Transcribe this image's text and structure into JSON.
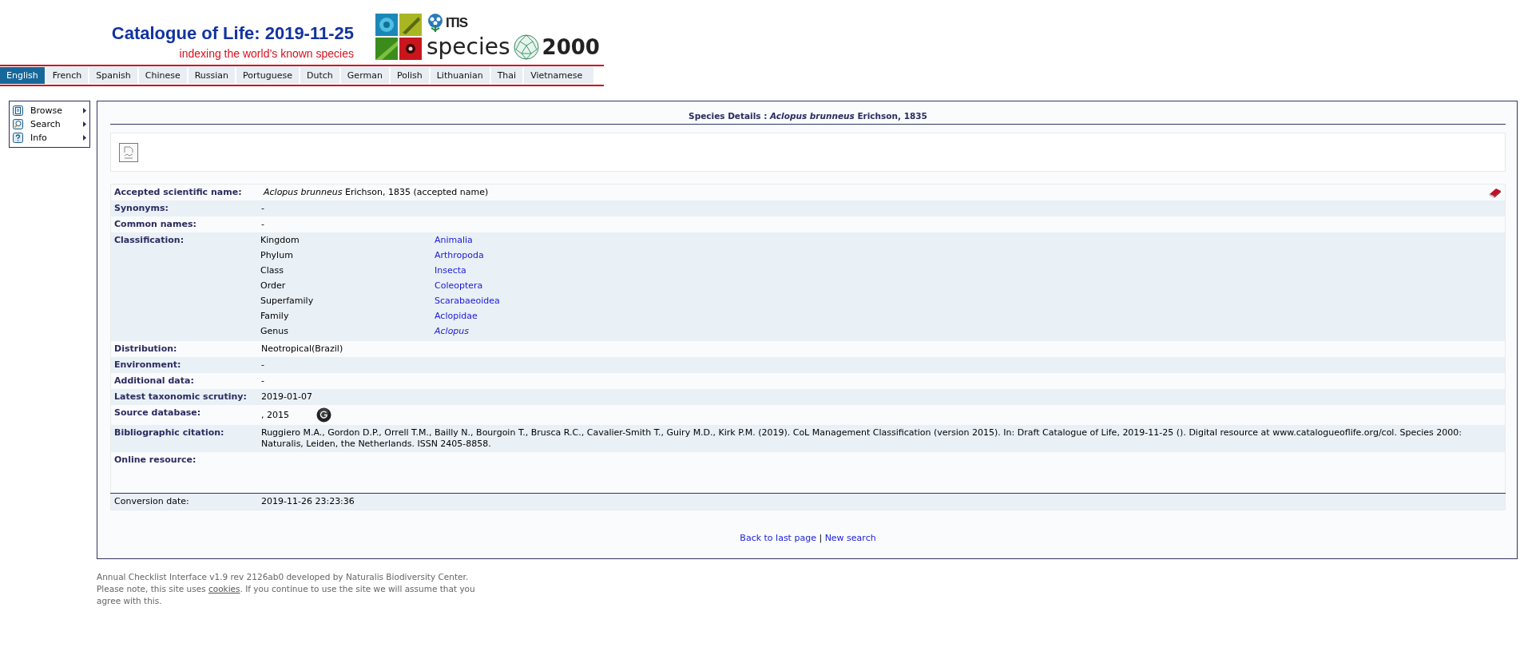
{
  "header": {
    "title": "Catalogue of Life: 2019-11-25",
    "tagline": "indexing the world’s known species",
    "logo_itis": "ITIS",
    "logo_species": "species",
    "logo_year": "2000"
  },
  "languages": [
    {
      "label": "English",
      "selected": true
    },
    {
      "label": "French",
      "selected": false
    },
    {
      "label": "Spanish",
      "selected": false
    },
    {
      "label": "Chinese",
      "selected": false
    },
    {
      "label": "Russian",
      "selected": false
    },
    {
      "label": "Portuguese",
      "selected": false
    },
    {
      "label": "Dutch",
      "selected": false
    },
    {
      "label": "German",
      "selected": false
    },
    {
      "label": "Polish",
      "selected": false
    },
    {
      "label": "Lithuanian",
      "selected": false
    },
    {
      "label": "Thai",
      "selected": false
    },
    {
      "label": "Vietnamese",
      "selected": false
    }
  ],
  "menu": [
    {
      "label": "Browse",
      "kind": "browse"
    },
    {
      "label": "Search",
      "kind": "search"
    },
    {
      "label": "Info",
      "kind": "info"
    }
  ],
  "panel": {
    "title": "Species Details : *Aclopus brunneus* Erichson, 1835",
    "details": [
      {
        "kind": "accepted",
        "label": "Accepted scientific name:",
        "value": "*Aclopus brunneus* Erichson, 1835 (accepted name)"
      },
      {
        "kind": "text",
        "label": "Synonyms:",
        "value": "-"
      },
      {
        "kind": "text",
        "label": "Common names:",
        "value": "-"
      },
      {
        "kind": "classification",
        "label": "Classification:",
        "ranks": [
          {
            "rank": "Kingdom",
            "taxon": "Animalia"
          },
          {
            "rank": "Phylum",
            "taxon": "Arthropoda"
          },
          {
            "rank": "Class",
            "taxon": "Insecta"
          },
          {
            "rank": "Order",
            "taxon": "Coleoptera"
          },
          {
            "rank": "Superfamily",
            "taxon": "Scarabaeoidea"
          },
          {
            "rank": "Family",
            "taxon": "Aclopidae"
          },
          {
            "rank": "Genus",
            "taxon": "*Aclopus*"
          }
        ]
      },
      {
        "kind": "text",
        "label": "Distribution:",
        "value": "Neotropical(Brazil)"
      },
      {
        "kind": "text",
        "label": "Environment:",
        "value": "-"
      },
      {
        "kind": "text",
        "label": "Additional data:",
        "value": "-"
      },
      {
        "kind": "text",
        "label": "Latest taxonomic scrutiny:",
        "value": "2019-01-07"
      },
      {
        "kind": "source",
        "label": "Source database:",
        "value": ", 2015"
      },
      {
        "kind": "text",
        "label": "Bibliographic citation:",
        "value": "Ruggiero M.A., Gordon D.P., Orrell T.M., Bailly N., Bourgoin T., Brusca R.C., Cavalier-Smith T., Guiry M.D., Kirk P.M. (2019). CoL Management Classification (version 2015). In: Draft Catalogue of Life, 2019-11-25 (). Digital resource at www.catalogueoflife.org/col. Species 2000: Naturalis, Leiden, the Netherlands. ISSN 2405-8858."
      },
      {
        "kind": "empty",
        "label": "Online resource:"
      }
    ],
    "conversion": {
      "label": "Conversion date:",
      "value": "2019-11-26 23:23:36"
    },
    "links": {
      "back": "Back to last page",
      "separator": "|",
      "new": "New search"
    }
  },
  "footer": {
    "before": "Annual Checklist Interface v1.9 rev 2126ab0 developed by Naturalis Biodiversity Center. Please note, this site uses ",
    "link": "cookies",
    "after": ". If you continue to use the site we will assume that you agree with this."
  }
}
